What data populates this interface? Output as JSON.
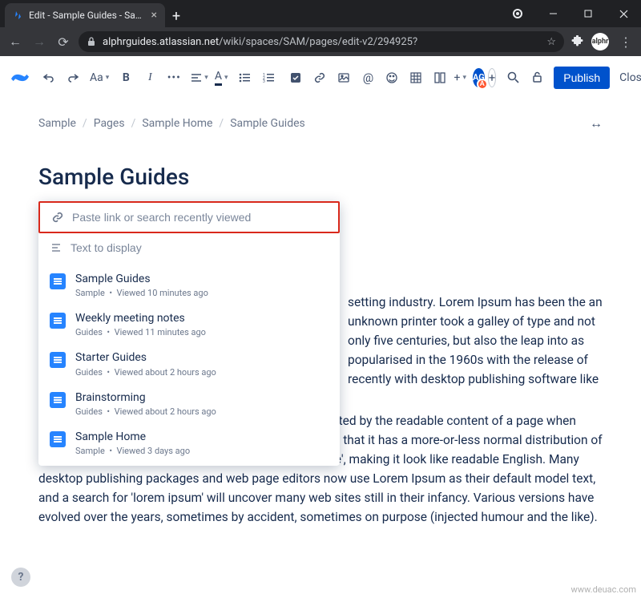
{
  "browser": {
    "tab_title": "Edit - Sample Guides - Sample -",
    "url_host": "alphrguides.atlassian.net",
    "url_path": "/wiki/spaces/SAM/pages/edit-v2/294925?"
  },
  "toolbar": {
    "text_style": "Aa",
    "bold": "B",
    "italic": "I",
    "color_a": "A",
    "plus": "+",
    "avatar_initials": "AG",
    "avatar_badge": "A",
    "publish_label": "Publish",
    "close_label": "Close"
  },
  "breadcrumb": [
    "Sample",
    "Pages",
    "Sample Home",
    "Sample Guides"
  ],
  "page": {
    "title": "Sample Guides",
    "link_placeholder": "Paste link or search recently viewed",
    "display_placeholder": "Text to display",
    "suggestions": [
      {
        "title": "Sample Guides",
        "space": "Sample",
        "viewed": "Viewed 10 minutes ago"
      },
      {
        "title": "Weekly meeting notes",
        "space": "Guides",
        "viewed": "Viewed 11 minutes ago"
      },
      {
        "title": "Starter Guides",
        "space": "Guides",
        "viewed": "Viewed about 2 hours ago"
      },
      {
        "title": "Brainstorming",
        "space": "Guides",
        "viewed": "Viewed about 2 hours ago"
      },
      {
        "title": "Sample Home",
        "space": "Sample",
        "viewed": "Viewed 3 days ago"
      }
    ],
    "paragraph1_right": "setting industry. Lorem Ipsum has been the an unknown printer took a galley of type and not only five centuries, but also the leap into as popularised in the 1960s with the release of recently with desktop publishing software like",
    "paragraph2": "It is a long established fact that a reader will be distracted by the readable content of a page when looking at its layout. The point of using Lorem Ipsum is that it has a more-or-less normal distribution of letters, as opposed to using 'Content here, content here', making it look like readable English. Many desktop publishing packages and web page editors now use Lorem Ipsum as their default model text, and a search for 'lorem ipsum' will uncover many web sites still in their infancy. Various versions have evolved over the years, sometimes by accident, sometimes on purpose (injected humour and the like)."
  },
  "watermark": "www.deuac.com"
}
